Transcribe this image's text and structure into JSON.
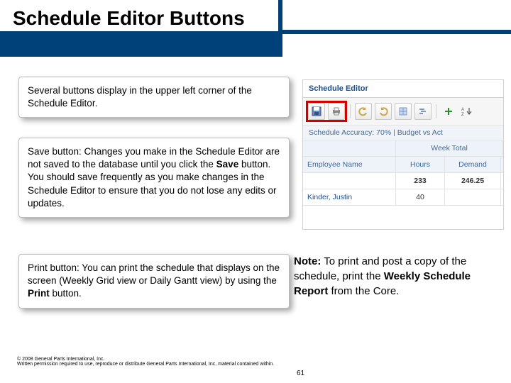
{
  "title": "Schedule Editor Buttons",
  "boxes": {
    "intro": "Several buttons display in the upper left corner of the Schedule Editor.",
    "save_pre": "Save button: Changes you make in the Schedule Editor are not saved to the database until you click the ",
    "save_bold": "Save",
    "save_post": " button. You should save frequently as you make changes in the Schedule Editor to ensure that you do not lose any edits or updates.",
    "print_pre": "Print  button: You can print the schedule that displays on the screen (Weekly Grid view or Daily Gantt view) by using the ",
    "print_bold": "Print",
    "print_post": " button."
  },
  "note": {
    "lead": "Note:",
    "mid": " To print and post a copy of the schedule, print the ",
    "bold": "Weekly Schedule Report",
    "tail": " from the Core."
  },
  "screenshot": {
    "title": "Schedule Editor",
    "status": "Schedule Accuracy: 70%   |   Budget vs Act",
    "week_total": "Week Total",
    "cols": {
      "name": "Employee Name",
      "hours": "Hours",
      "demand": "Demand"
    },
    "totals": {
      "hours": "233",
      "demand": "246.25"
    },
    "rows": [
      {
        "name": "Kinder, Justin",
        "hours": "40",
        "demand": ""
      }
    ]
  },
  "footer": {
    "line1": "© 2008 General Parts International, Inc.",
    "line2": "Written permission required to use, reproduce or distribute General Parts International, Inc. material contained within."
  },
  "page": "61"
}
